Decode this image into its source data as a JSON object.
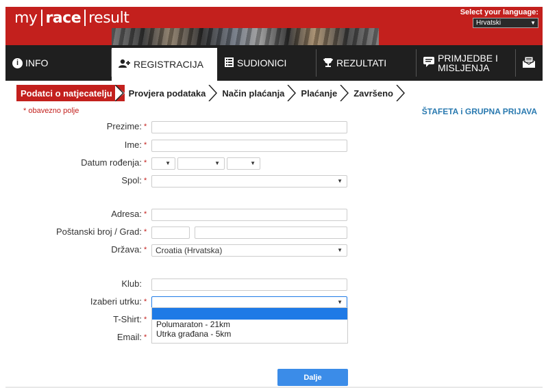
{
  "header": {
    "logo": {
      "w1": "my",
      "w2": "race",
      "w3": "result"
    },
    "language_label": "Select your language:",
    "language_value": "Hrvatski"
  },
  "nav": {
    "items": [
      {
        "label": "INFO",
        "icon": "info-icon"
      },
      {
        "label": "REGISTRACIJA",
        "icon": "user-add-icon"
      },
      {
        "label": "SUDIONICI",
        "icon": "list-icon"
      },
      {
        "label": "REZULTATI",
        "icon": "trophy-icon"
      },
      {
        "label_line1": "PRIMJEDBE I",
        "label_line2": "MISLJENJA",
        "icon": "comment-icon"
      },
      {
        "icon": "inbox-icon"
      }
    ]
  },
  "steps": [
    "Podatci o natjecatelju",
    "Provjera podataka",
    "Način plaćanja",
    "Plaćanje",
    "Završeno"
  ],
  "form": {
    "required_note": "* obavezno polje",
    "relay_link": "ŠTAFETA i GRUPNA PRIJAVA",
    "required_mark": "*",
    "labels": {
      "prezime": "Prezime:",
      "ime": "Ime:",
      "datum": "Datum rođenja:",
      "spol": "Spol:",
      "adresa": "Adresa:",
      "postanski": "Poštanski broj / Grad:",
      "drzava": "Država:",
      "klub": "Klub:",
      "utrka": "Izaberi utrku:",
      "tshirt": "T-Shirt:",
      "email": "Email:"
    },
    "values": {
      "drzava": "Croatia (Hrvatska)"
    },
    "race_options": [
      "Polumaraton - 21km",
      "Utrka građana - 5km"
    ],
    "submit_label": "Dalje"
  },
  "colors": {
    "brand_red": "#c3201d",
    "nav_dark": "#1f1f1f",
    "link_blue": "#2a7ab0",
    "button_blue": "#3b8ce8",
    "highlight_blue": "#1e7ae6"
  }
}
